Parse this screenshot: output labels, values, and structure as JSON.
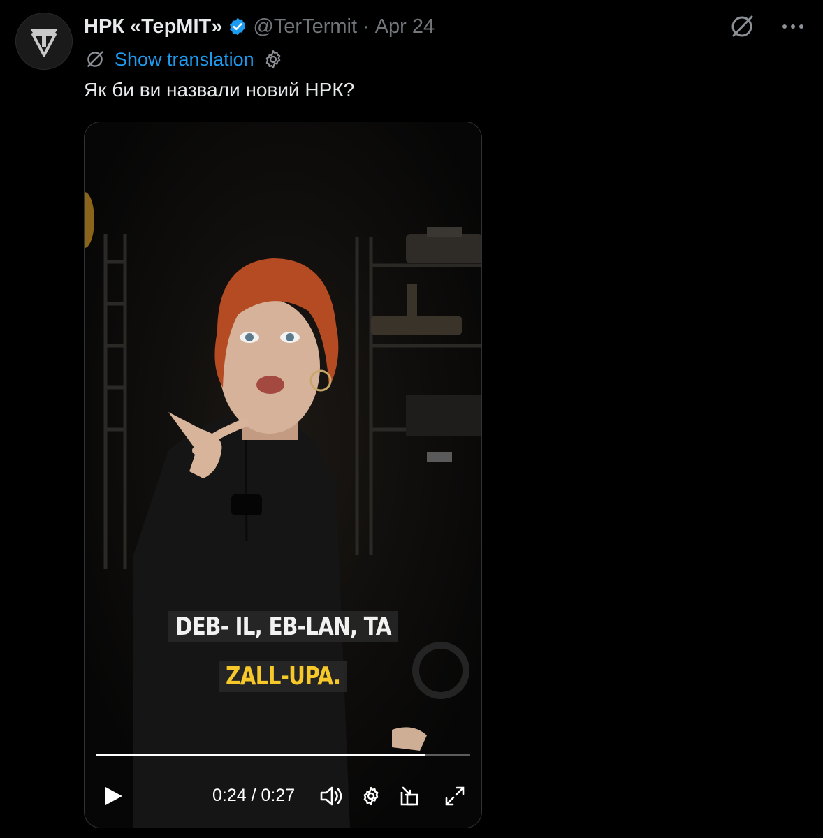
{
  "tweet": {
    "display_name": "НРК «ТерМІТ»",
    "handle": "@TerTermit",
    "separator": "·",
    "date": "Apr 24",
    "show_translation": "Show translation",
    "text": "Як би ви назвали новий НРК?"
  },
  "icons": {
    "avatar": "termit-logo",
    "verified": "verified-badge-icon",
    "grok": "grok-icon",
    "more": "more-icon",
    "translate": "translate-icon",
    "settings": "settings-icon"
  },
  "video": {
    "captions": {
      "line1": "DEB- IL, EB-LAN, TA",
      "line2": "ZALL-UPA."
    },
    "current_time": "0:24",
    "time_separator": "/",
    "duration": "0:27",
    "progress": 0.88,
    "controls": [
      "play-icon",
      "volume-icon",
      "settings-icon",
      "picture-in-picture-icon",
      "fullscreen-icon"
    ]
  },
  "colors": {
    "background": "#000000",
    "text": "#e7e9ea",
    "muted": "#71767b",
    "link": "#1d9bf0",
    "verified": "#1d9bf0",
    "caption_highlight": "#f7c82a"
  }
}
